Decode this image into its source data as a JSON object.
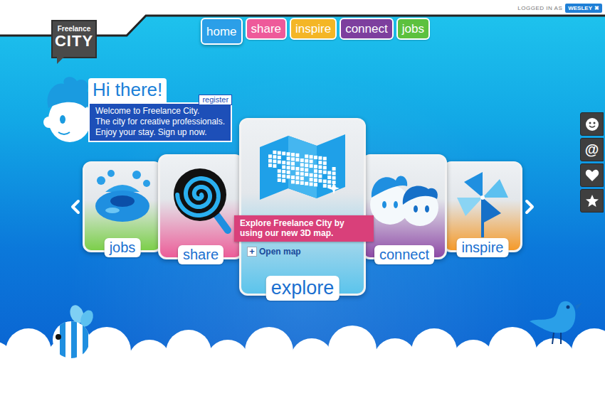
{
  "header": {
    "logo": {
      "top": "Freelance",
      "bottom": "CITY"
    },
    "user": {
      "label": "LOGGED IN AS",
      "name": "WESLEY",
      "close": "✖"
    }
  },
  "nav": [
    {
      "label": "home",
      "selected": true,
      "color": "#2b9fe8"
    },
    {
      "label": "share",
      "selected": false,
      "color": "#ee5a9a"
    },
    {
      "label": "inspire",
      "selected": false,
      "color": "#f4b626"
    },
    {
      "label": "connect",
      "selected": false,
      "color": "#7d3f9e"
    },
    {
      "label": "jobs",
      "selected": false,
      "color": "#5cc13e"
    }
  ],
  "welcome": {
    "greeting": "Hi there!",
    "register": "register",
    "lines": [
      "Welcome to Freelance City.",
      "The city for creative professionals.",
      "Enjoy your stay. Sign up now."
    ]
  },
  "side_toolbar": {
    "mention": "@"
  },
  "carousel": {
    "cards": [
      {
        "label": "jobs",
        "selected": false,
        "color": "#7ccf4a"
      },
      {
        "label": "share",
        "selected": false,
        "color": "#ec5d98"
      },
      {
        "label": "explore",
        "selected": true,
        "color": "#5bc4ec"
      },
      {
        "label": "connect",
        "selected": false,
        "color": "#8e4aa6"
      },
      {
        "label": "inspire",
        "selected": false,
        "color": "#f59a2a"
      }
    ],
    "tooltip": {
      "text": "Explore Freelance City by using our new 3D map.",
      "action_icon": "+",
      "action": "Open map"
    }
  }
}
